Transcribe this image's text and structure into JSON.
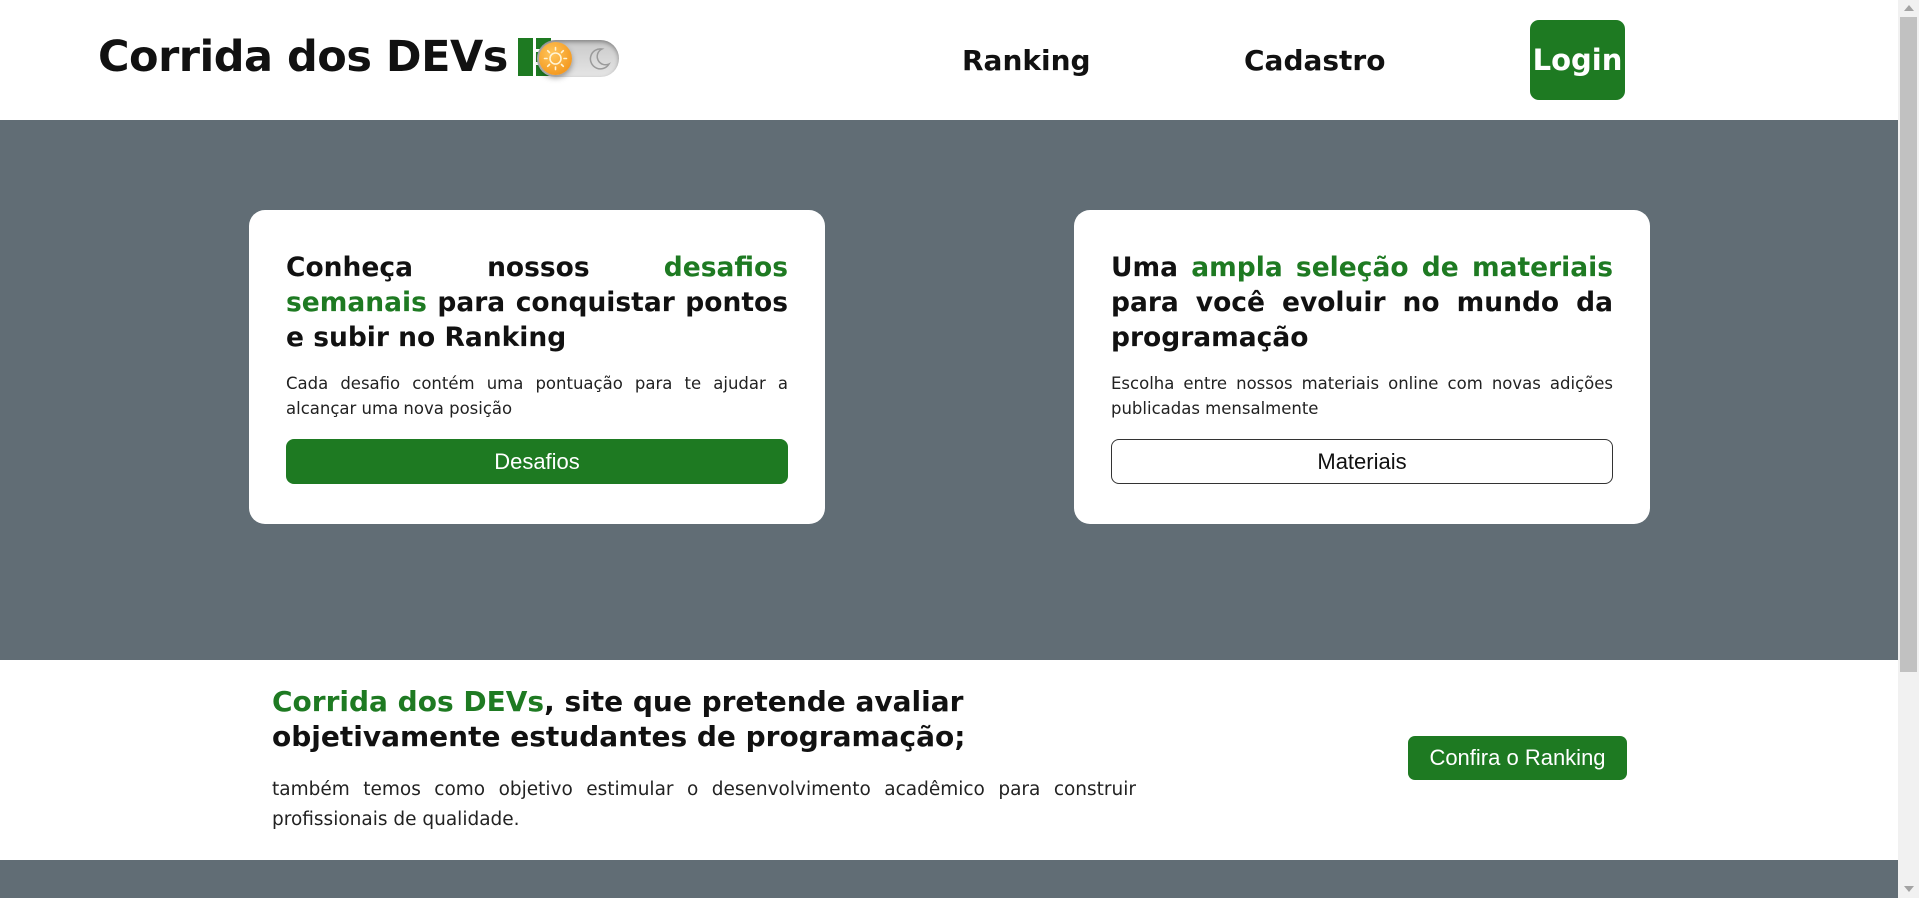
{
  "header": {
    "brand": "Corrida dos DEVs",
    "logo_icon": "bars-logo-icon",
    "theme_toggle": {
      "state": "light",
      "on_icon": "sun-icon",
      "off_icon": "moon-icon"
    },
    "nav": [
      {
        "label": "Ranking"
      },
      {
        "label": "Cadastro"
      }
    ],
    "login_label": "Login"
  },
  "cards": [
    {
      "title_parts": [
        "Conheça nossos ",
        "desafios semanais",
        " para conquistar pontos e subir no Ranking"
      ],
      "text": "Cada desafio contém uma pontuação para te ajudar a alcançar uma nova posição",
      "button_label": "Desafios"
    },
    {
      "title_parts": [
        "Uma ",
        "ampla seleção de materiais",
        " para você evoluir no mundo da programação"
      ],
      "text": "Escolha entre nossos materiais online com novas adições publicadas mensalmente",
      "button_label": "Materiais"
    }
  ],
  "info": {
    "title_highlight": "Corrida dos DEVs",
    "title_rest": ", site que pretende avaliar objetivamente estudantes de programação;",
    "text": "também temos como objetivo estimular o desenvolvimento acadêmico para construir profissionais de qualidade.",
    "button_label": "Confira o Ranking"
  },
  "colors": {
    "accent": "#1e7a22",
    "hero_bg": "#616d75",
    "card_bg": "#ffffff"
  }
}
